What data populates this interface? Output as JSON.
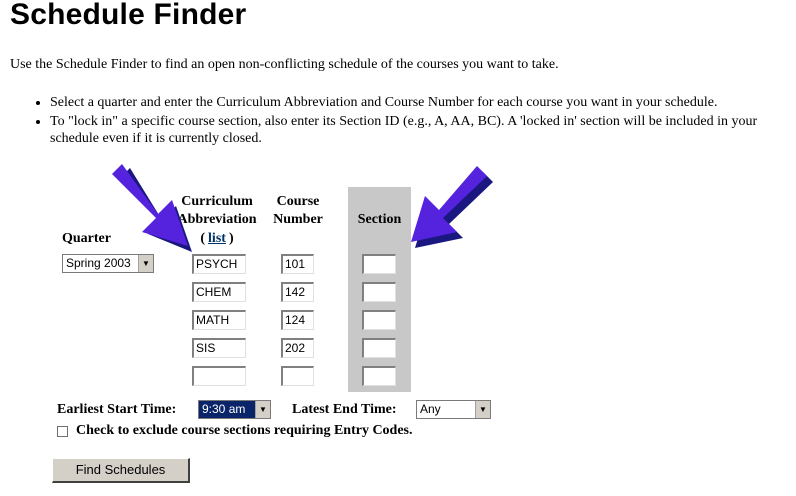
{
  "page": {
    "title": "Schedule Finder",
    "intro": "Use the Schedule Finder to find an open non-conflicting schedule of the courses you want to take.",
    "bullets": [
      "Select a quarter and enter the Curriculum Abbreviation and Course Number for each course you want in your schedule.",
      "To \"lock in\" a specific course section, also enter its Section ID (e.g., A, AA, BC). A 'locked in' section will be included in your schedule even if it is currently closed."
    ]
  },
  "table": {
    "quarter_label": "Quarter",
    "curriculum_label_1": "Curriculum",
    "curriculum_label_2": "Abbreviation",
    "list_open": "(",
    "list_link": "list",
    "list_close": ")",
    "course_label_1": "Course",
    "course_label_2": "Number",
    "section_label": "Section",
    "quarter_value": "Spring 2003",
    "rows": [
      {
        "curriculum": "PSYCH",
        "number": "101",
        "section": ""
      },
      {
        "curriculum": "CHEM",
        "number": "142",
        "section": ""
      },
      {
        "curriculum": "MATH",
        "number": "124",
        "section": ""
      },
      {
        "curriculum": "SIS",
        "number": "202",
        "section": ""
      },
      {
        "curriculum": "",
        "number": "",
        "section": ""
      }
    ]
  },
  "times": {
    "earliest_label": "Earliest Start Time:",
    "earliest_value": "9:30 am",
    "latest_label": "Latest End Time:",
    "latest_value": "Any"
  },
  "options": {
    "exclude_label": "Check to exclude course sections requiring Entry Codes."
  },
  "actions": {
    "find_label": "Find Schedules"
  },
  "colors": {
    "arrow_fill": "#5522dd",
    "arrow_shade": "#1a1880",
    "section_column": "#c8c8c8",
    "link": "#003366"
  }
}
